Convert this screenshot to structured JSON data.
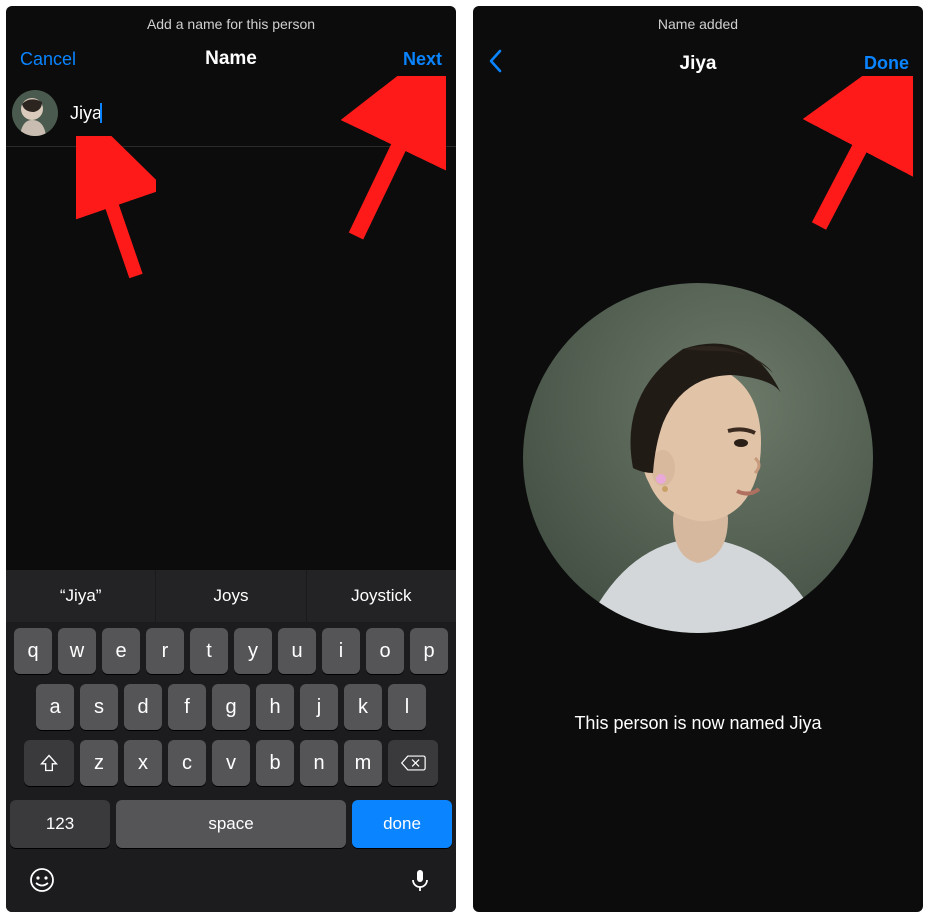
{
  "left": {
    "caption": "Add a name for this person",
    "nav": {
      "cancel": "Cancel",
      "title": "Name",
      "next": "Next"
    },
    "input": {
      "value": "Jiya"
    },
    "suggestions": [
      "“Jiya”",
      "Joys",
      "Joystick"
    ],
    "keyboard": {
      "row1": [
        "q",
        "w",
        "e",
        "r",
        "t",
        "y",
        "u",
        "i",
        "o",
        "p"
      ],
      "row2": [
        "a",
        "s",
        "d",
        "f",
        "g",
        "h",
        "j",
        "k",
        "l"
      ],
      "row3": [
        "z",
        "x",
        "c",
        "v",
        "b",
        "n",
        "m"
      ],
      "numbers": "123",
      "space": "space",
      "done": "done"
    }
  },
  "right": {
    "caption": "Name added",
    "nav": {
      "title": "Jiya",
      "done": "Done"
    },
    "confirm": "This person is now named Jiya"
  }
}
